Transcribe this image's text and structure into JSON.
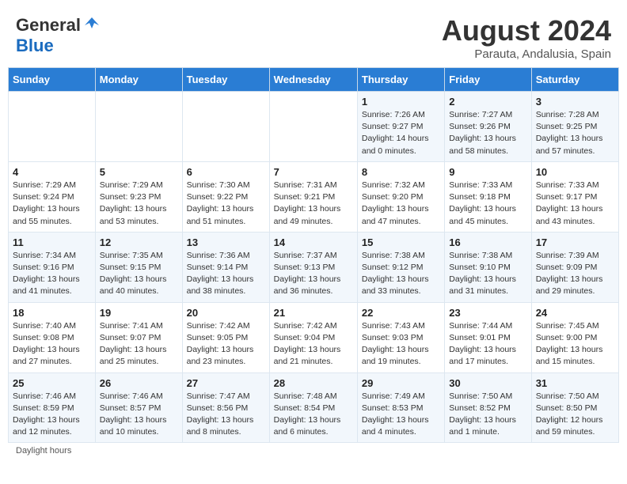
{
  "header": {
    "logo_general": "General",
    "logo_blue": "Blue",
    "month_title": "August 2024",
    "subtitle": "Parauta, Andalusia, Spain"
  },
  "weekdays": [
    "Sunday",
    "Monday",
    "Tuesday",
    "Wednesday",
    "Thursday",
    "Friday",
    "Saturday"
  ],
  "weeks": [
    [
      {
        "day": "",
        "sunrise": "",
        "sunset": "",
        "daylight": ""
      },
      {
        "day": "",
        "sunrise": "",
        "sunset": "",
        "daylight": ""
      },
      {
        "day": "",
        "sunrise": "",
        "sunset": "",
        "daylight": ""
      },
      {
        "day": "",
        "sunrise": "",
        "sunset": "",
        "daylight": ""
      },
      {
        "day": "1",
        "sunrise": "Sunrise: 7:26 AM",
        "sunset": "Sunset: 9:27 PM",
        "daylight": "Daylight: 14 hours and 0 minutes."
      },
      {
        "day": "2",
        "sunrise": "Sunrise: 7:27 AM",
        "sunset": "Sunset: 9:26 PM",
        "daylight": "Daylight: 13 hours and 58 minutes."
      },
      {
        "day": "3",
        "sunrise": "Sunrise: 7:28 AM",
        "sunset": "Sunset: 9:25 PM",
        "daylight": "Daylight: 13 hours and 57 minutes."
      }
    ],
    [
      {
        "day": "4",
        "sunrise": "Sunrise: 7:29 AM",
        "sunset": "Sunset: 9:24 PM",
        "daylight": "Daylight: 13 hours and 55 minutes."
      },
      {
        "day": "5",
        "sunrise": "Sunrise: 7:29 AM",
        "sunset": "Sunset: 9:23 PM",
        "daylight": "Daylight: 13 hours and 53 minutes."
      },
      {
        "day": "6",
        "sunrise": "Sunrise: 7:30 AM",
        "sunset": "Sunset: 9:22 PM",
        "daylight": "Daylight: 13 hours and 51 minutes."
      },
      {
        "day": "7",
        "sunrise": "Sunrise: 7:31 AM",
        "sunset": "Sunset: 9:21 PM",
        "daylight": "Daylight: 13 hours and 49 minutes."
      },
      {
        "day": "8",
        "sunrise": "Sunrise: 7:32 AM",
        "sunset": "Sunset: 9:20 PM",
        "daylight": "Daylight: 13 hours and 47 minutes."
      },
      {
        "day": "9",
        "sunrise": "Sunrise: 7:33 AM",
        "sunset": "Sunset: 9:18 PM",
        "daylight": "Daylight: 13 hours and 45 minutes."
      },
      {
        "day": "10",
        "sunrise": "Sunrise: 7:33 AM",
        "sunset": "Sunset: 9:17 PM",
        "daylight": "Daylight: 13 hours and 43 minutes."
      }
    ],
    [
      {
        "day": "11",
        "sunrise": "Sunrise: 7:34 AM",
        "sunset": "Sunset: 9:16 PM",
        "daylight": "Daylight: 13 hours and 41 minutes."
      },
      {
        "day": "12",
        "sunrise": "Sunrise: 7:35 AM",
        "sunset": "Sunset: 9:15 PM",
        "daylight": "Daylight: 13 hours and 40 minutes."
      },
      {
        "day": "13",
        "sunrise": "Sunrise: 7:36 AM",
        "sunset": "Sunset: 9:14 PM",
        "daylight": "Daylight: 13 hours and 38 minutes."
      },
      {
        "day": "14",
        "sunrise": "Sunrise: 7:37 AM",
        "sunset": "Sunset: 9:13 PM",
        "daylight": "Daylight: 13 hours and 36 minutes."
      },
      {
        "day": "15",
        "sunrise": "Sunrise: 7:38 AM",
        "sunset": "Sunset: 9:12 PM",
        "daylight": "Daylight: 13 hours and 33 minutes."
      },
      {
        "day": "16",
        "sunrise": "Sunrise: 7:38 AM",
        "sunset": "Sunset: 9:10 PM",
        "daylight": "Daylight: 13 hours and 31 minutes."
      },
      {
        "day": "17",
        "sunrise": "Sunrise: 7:39 AM",
        "sunset": "Sunset: 9:09 PM",
        "daylight": "Daylight: 13 hours and 29 minutes."
      }
    ],
    [
      {
        "day": "18",
        "sunrise": "Sunrise: 7:40 AM",
        "sunset": "Sunset: 9:08 PM",
        "daylight": "Daylight: 13 hours and 27 minutes."
      },
      {
        "day": "19",
        "sunrise": "Sunrise: 7:41 AM",
        "sunset": "Sunset: 9:07 PM",
        "daylight": "Daylight: 13 hours and 25 minutes."
      },
      {
        "day": "20",
        "sunrise": "Sunrise: 7:42 AM",
        "sunset": "Sunset: 9:05 PM",
        "daylight": "Daylight: 13 hours and 23 minutes."
      },
      {
        "day": "21",
        "sunrise": "Sunrise: 7:42 AM",
        "sunset": "Sunset: 9:04 PM",
        "daylight": "Daylight: 13 hours and 21 minutes."
      },
      {
        "day": "22",
        "sunrise": "Sunrise: 7:43 AM",
        "sunset": "Sunset: 9:03 PM",
        "daylight": "Daylight: 13 hours and 19 minutes."
      },
      {
        "day": "23",
        "sunrise": "Sunrise: 7:44 AM",
        "sunset": "Sunset: 9:01 PM",
        "daylight": "Daylight: 13 hours and 17 minutes."
      },
      {
        "day": "24",
        "sunrise": "Sunrise: 7:45 AM",
        "sunset": "Sunset: 9:00 PM",
        "daylight": "Daylight: 13 hours and 15 minutes."
      }
    ],
    [
      {
        "day": "25",
        "sunrise": "Sunrise: 7:46 AM",
        "sunset": "Sunset: 8:59 PM",
        "daylight": "Daylight: 13 hours and 12 minutes."
      },
      {
        "day": "26",
        "sunrise": "Sunrise: 7:46 AM",
        "sunset": "Sunset: 8:57 PM",
        "daylight": "Daylight: 13 hours and 10 minutes."
      },
      {
        "day": "27",
        "sunrise": "Sunrise: 7:47 AM",
        "sunset": "Sunset: 8:56 PM",
        "daylight": "Daylight: 13 hours and 8 minutes."
      },
      {
        "day": "28",
        "sunrise": "Sunrise: 7:48 AM",
        "sunset": "Sunset: 8:54 PM",
        "daylight": "Daylight: 13 hours and 6 minutes."
      },
      {
        "day": "29",
        "sunrise": "Sunrise: 7:49 AM",
        "sunset": "Sunset: 8:53 PM",
        "daylight": "Daylight: 13 hours and 4 minutes."
      },
      {
        "day": "30",
        "sunrise": "Sunrise: 7:50 AM",
        "sunset": "Sunset: 8:52 PM",
        "daylight": "Daylight: 13 hours and 1 minute."
      },
      {
        "day": "31",
        "sunrise": "Sunrise: 7:50 AM",
        "sunset": "Sunset: 8:50 PM",
        "daylight": "Daylight: 12 hours and 59 minutes."
      }
    ]
  ],
  "footer": {
    "note": "Daylight hours"
  }
}
